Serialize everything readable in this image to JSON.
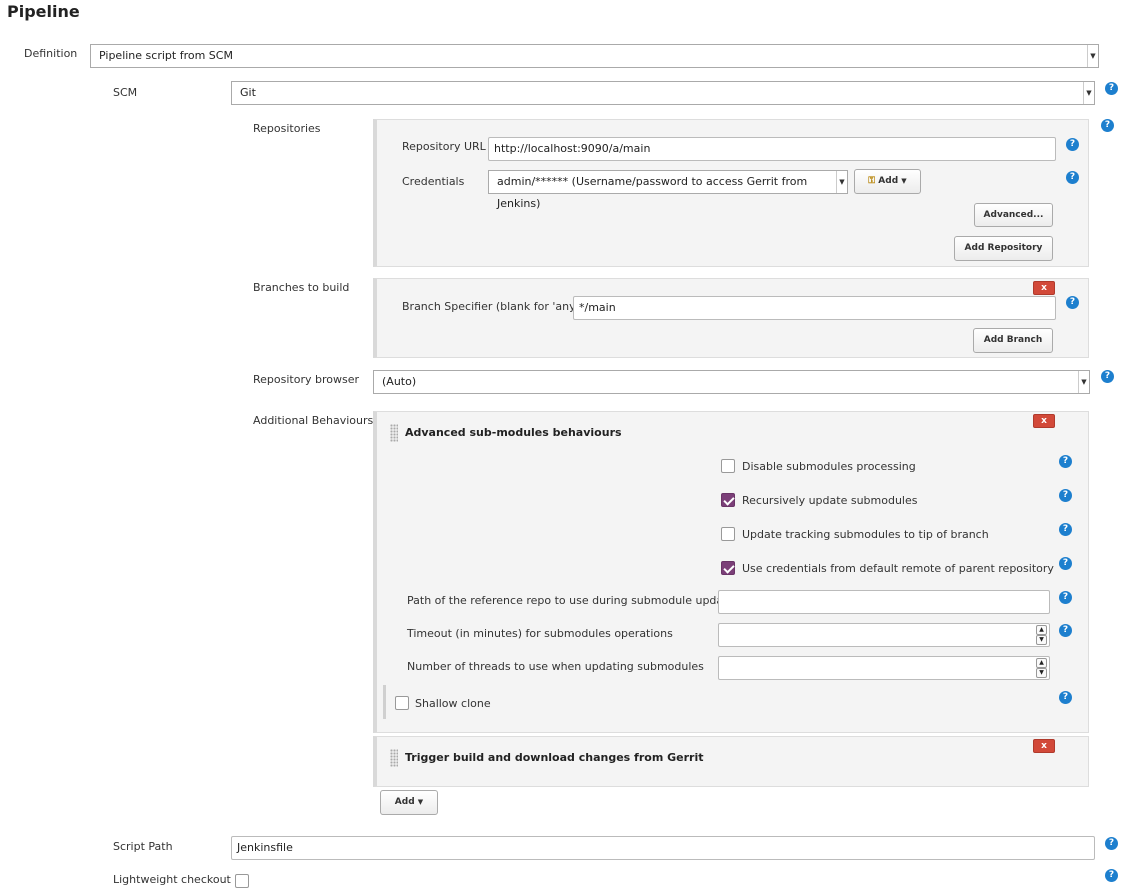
{
  "section_title": "Pipeline",
  "definition": {
    "label": "Definition",
    "value": "Pipeline script from SCM"
  },
  "scm": {
    "label": "SCM",
    "value": "Git"
  },
  "repositories": {
    "label": "Repositories",
    "url_label": "Repository URL",
    "url_value": "http://localhost:9090/a/main",
    "credentials_label": "Credentials",
    "credentials_value": "admin/****** (Username/password to access Gerrit from Jenkins)",
    "add_label": "Add",
    "advanced_label": "Advanced...",
    "add_repository_label": "Add Repository"
  },
  "branches": {
    "label": "Branches to build",
    "specifier_label": "Branch Specifier (blank for 'any')",
    "specifier_value": "*/main",
    "delete_label": "x",
    "add_branch_label": "Add Branch"
  },
  "repo_browser": {
    "label": "Repository browser",
    "value": "(Auto)"
  },
  "behaviours": {
    "label": "Additional Behaviours",
    "submodules": {
      "title": "Advanced sub-modules behaviours",
      "delete_label": "x",
      "options": [
        {
          "label": "Disable submodules processing",
          "checked": false
        },
        {
          "label": "Recursively update submodules",
          "checked": true
        },
        {
          "label": "Update tracking submodules to tip of branch",
          "checked": false
        },
        {
          "label": "Use credentials from default remote of parent repository",
          "checked": true
        }
      ],
      "reference_repo_label": "Path of the reference repo to use during submodule update",
      "timeout_label": "Timeout (in minutes) for submodules operations",
      "threads_label": "Number of threads to use when updating submodules",
      "shallow_clone_label": "Shallow clone"
    },
    "gerrit": {
      "title": "Trigger build and download changes from Gerrit",
      "delete_label": "x"
    },
    "add_label": "Add"
  },
  "script_path": {
    "label": "Script Path",
    "value": "Jenkinsfile"
  },
  "lightweight_checkout": {
    "label": "Lightweight checkout",
    "checked": false
  },
  "icons": {
    "help": "help-icon",
    "dropdown": "caret-down-icon",
    "key": "key-icon"
  },
  "colors": {
    "help": "#1d7fce",
    "delete": "#d24939",
    "checkbox_checked": "#7b3f78"
  }
}
